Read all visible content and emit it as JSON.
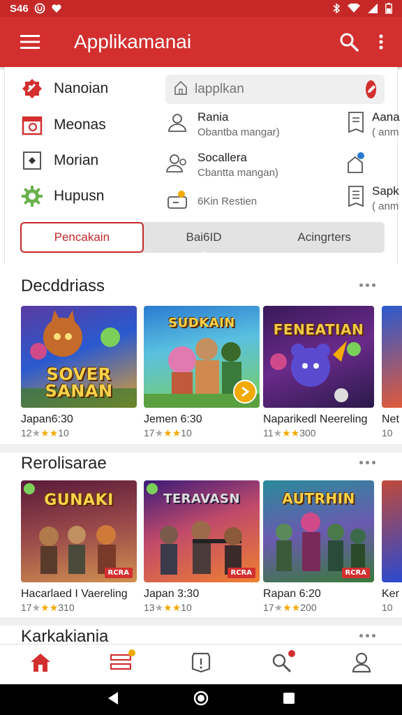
{
  "status_bar": {
    "time": "S46",
    "icons": [
      "circle-u-icon",
      "heart-icon",
      "bluetooth-icon",
      "wifi-icon",
      "signal-icon",
      "battery-icon"
    ]
  },
  "app_bar": {
    "title": "Applikamanai",
    "icons": [
      "menu-icon",
      "search-icon",
      "more-vert-icon"
    ]
  },
  "side_menu": [
    {
      "label": "Nanoian",
      "icon": "badge-icon"
    },
    {
      "label": "Meonas",
      "icon": "calendar-icon"
    },
    {
      "label": "Morian",
      "icon": "square-icon"
    },
    {
      "label": "Hupusn",
      "icon": "gear-icon"
    }
  ],
  "search": {
    "placeholder": "lapplkan",
    "icon": "home-icon",
    "clear_icon": "edit-icon"
  },
  "mid_items": [
    {
      "title": "Rania",
      "subtitle": "Obantba mangar)",
      "icon": "user-icon"
    },
    {
      "title": "Socallera",
      "subtitle": "Cbantta mangan)",
      "icon": "users-icon"
    },
    {
      "title": "",
      "subtitle": "6Kin Restien",
      "icon": "video-icon"
    }
  ],
  "right_items": [
    {
      "title": "Aana",
      "subtitle": "( anm",
      "icon": "doc-icon"
    },
    {
      "title": "",
      "subtitle": "",
      "icon": "tag-icon"
    },
    {
      "title": "Sapk",
      "subtitle": "( anm",
      "icon": "list-icon"
    }
  ],
  "tabs": [
    {
      "label": "Pencakain",
      "active": true
    },
    {
      "label": "Bai6ID",
      "active": false
    },
    {
      "label": "Acingrters",
      "active": false
    }
  ],
  "sections": [
    {
      "title": "Decddriass",
      "cards": [
        {
          "art_text": "SOVER SANAN",
          "name": "Japan6:30",
          "rating_left": "12",
          "rating_right": "10",
          "badge": "",
          "colors": [
            "#3a2b7a",
            "#f0a030"
          ]
        },
        {
          "art_text": "SUDKAIN",
          "name": "Jemen 6:30",
          "rating_left": "17",
          "rating_right": "10",
          "badge": "",
          "colors": [
            "#2a7bd0",
            "#7bd05a"
          ]
        },
        {
          "art_text": "FENEATIAN",
          "name": "Naparikedl Neereling",
          "rating_left": "11",
          "rating_right": "300",
          "badge": "",
          "colors": [
            "#4a1a6a",
            "#d04a8a"
          ]
        },
        {
          "art_text": "",
          "name": "Net",
          "rating_left": "10",
          "rating_right": "",
          "badge": "",
          "colors": [
            "#2a5ad0",
            "#e05a3a"
          ]
        }
      ]
    },
    {
      "title": "Rerolisarae",
      "cards": [
        {
          "art_text": "GUNAKI",
          "name": "Hacarlaed I Vaereling",
          "rating_left": "17",
          "rating_right": "310",
          "badge": "RCRA",
          "colors": [
            "#6a2a4a",
            "#d09050"
          ]
        },
        {
          "art_text": "TERAVASN",
          "name": "Japan 3:30",
          "rating_left": "13",
          "rating_right": "10",
          "badge": "RCRA",
          "colors": [
            "#6a1a7a",
            "#f07030"
          ]
        },
        {
          "art_text": "AUTRHIN",
          "name": "Rapan 6:20",
          "rating_left": "17",
          "rating_right": "200",
          "badge": "RCRA",
          "colors": [
            "#2a8a8a",
            "#d04a8a"
          ]
        },
        {
          "art_text": "",
          "name": "Ker",
          "rating_left": "10",
          "rating_right": "",
          "badge": "",
          "colors": [
            "#c04a3a",
            "#2a4ad0"
          ]
        }
      ]
    },
    {
      "title": "Karkakiania",
      "cards": []
    }
  ],
  "bottom_nav": [
    {
      "icon": "home-icon",
      "active": true,
      "badge": false
    },
    {
      "icon": "list-icon",
      "active": false,
      "badge": true
    },
    {
      "icon": "alert-icon",
      "active": false,
      "badge": false
    },
    {
      "icon": "search-icon",
      "active": false,
      "badge": true
    },
    {
      "icon": "profile-icon",
      "active": false,
      "badge": false
    }
  ],
  "colors": {
    "primary": "#d32f2f",
    "primary_dark": "#c62828",
    "star": "#f2a900"
  }
}
